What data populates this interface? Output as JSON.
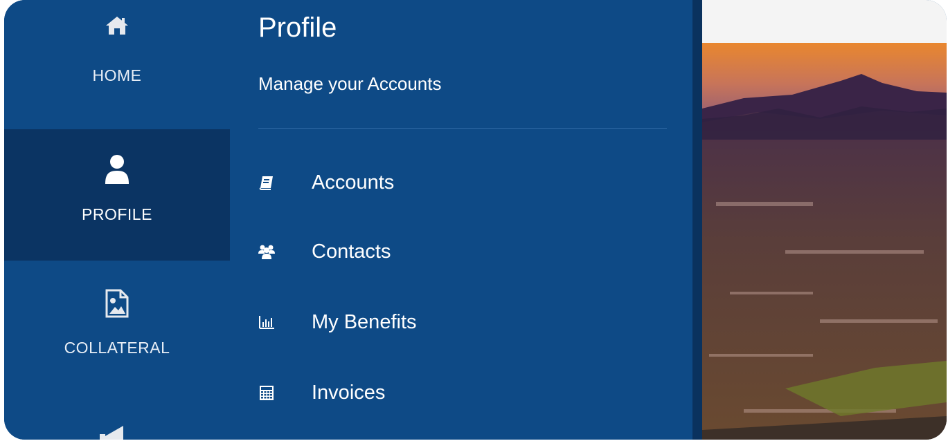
{
  "rail": {
    "items": [
      {
        "label": "HOME",
        "icon": "home-icon",
        "active": false
      },
      {
        "label": "PROFILE",
        "icon": "user-icon",
        "active": true
      },
      {
        "label": "COLLATERAL",
        "icon": "image-file-icon",
        "active": false
      },
      {
        "label": "",
        "icon": "megaphone-icon",
        "active": false
      }
    ]
  },
  "panel": {
    "title": "Profile",
    "subtitle": "Manage your Accounts",
    "items": [
      {
        "label": "Accounts",
        "icon": "book-icon"
      },
      {
        "label": "Contacts",
        "icon": "users-icon"
      },
      {
        "label": "My Benefits",
        "icon": "bar-chart-icon"
      },
      {
        "label": "Invoices",
        "icon": "calculator-icon"
      }
    ]
  },
  "colors": {
    "panel_bg": "#0e4a86",
    "active_bg": "#0b3463",
    "text": "#ffffff"
  }
}
